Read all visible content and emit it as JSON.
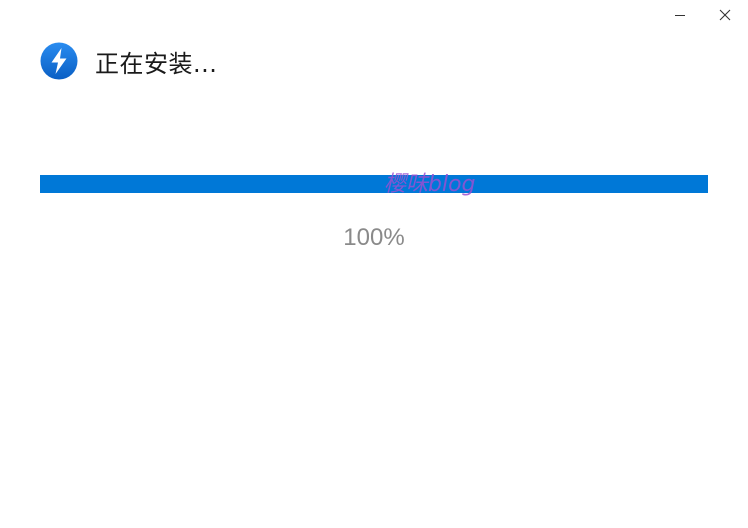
{
  "window": {
    "title": "正在安装...",
    "minimize_icon": "minimize-icon",
    "close_icon": "close-icon"
  },
  "app": {
    "icon": "lightning-bolt-icon",
    "brand_color": "#0078d7"
  },
  "progress": {
    "value_percent": 100,
    "label": "100%",
    "fill_color": "#0078d7"
  },
  "watermark": {
    "text": "樱味blog",
    "color": "#9b4fd2"
  }
}
